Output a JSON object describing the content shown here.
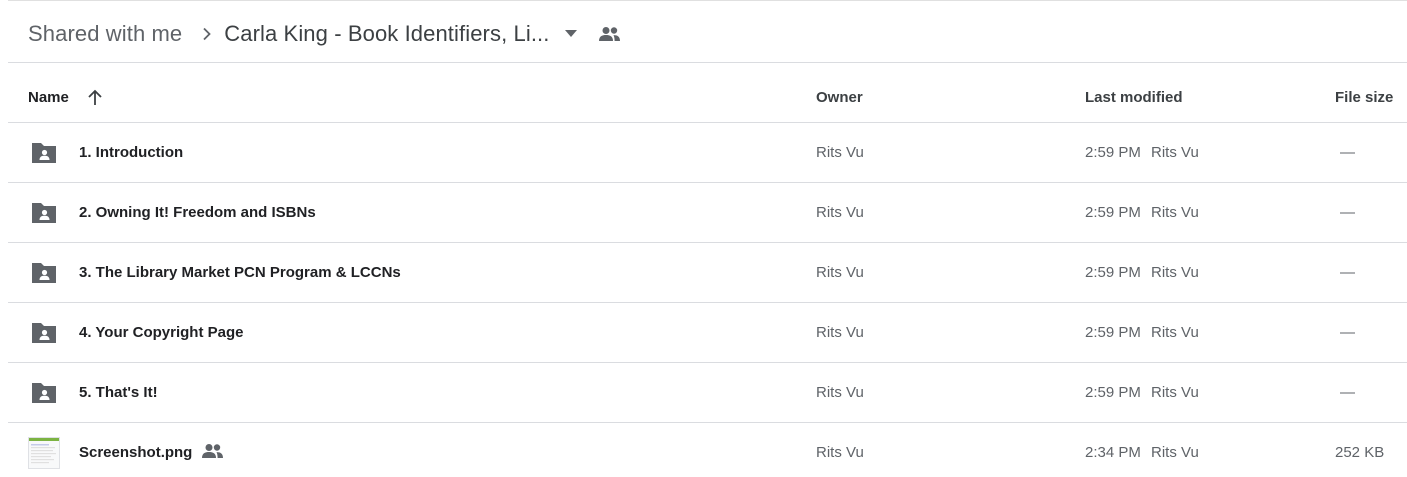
{
  "breadcrumb": {
    "root": "Shared with me",
    "current": "Carla King - Book Identifiers, Li..."
  },
  "columns": {
    "name": "Name",
    "owner": "Owner",
    "last_modified": "Last modified",
    "file_size": "File size"
  },
  "rows": [
    {
      "name": "1. Introduction",
      "type": "shared-folder-icon",
      "owner": "Rits Vu",
      "time": "2:59 PM",
      "modified_by": "Rits Vu",
      "size": "—"
    },
    {
      "name": "2. Owning It! Freedom and ISBNs",
      "type": "shared-folder-icon",
      "owner": "Rits Vu",
      "time": "2:59 PM",
      "modified_by": "Rits Vu",
      "size": "—"
    },
    {
      "name": "3. The Library Market PCN Program & LCCNs",
      "type": "shared-folder-icon",
      "owner": "Rits Vu",
      "time": "2:59 PM",
      "modified_by": "Rits Vu",
      "size": "—"
    },
    {
      "name": "4. Your Copyright Page",
      "type": "shared-folder-icon",
      "owner": "Rits Vu",
      "time": "2:59 PM",
      "modified_by": "Rits Vu",
      "size": "—"
    },
    {
      "name": "5. That's It!",
      "type": "shared-folder-icon",
      "owner": "Rits Vu",
      "time": "2:59 PM",
      "modified_by": "Rits Vu",
      "size": "—"
    },
    {
      "name": "Screenshot.png",
      "type": "image-thumbnail",
      "owner": "Rits Vu",
      "time": "2:34 PM",
      "modified_by": "Rits Vu",
      "size": "252 KB"
    }
  ],
  "colors": {
    "icon_gray": "#5f6368",
    "divider": "#dadce0",
    "text_primary": "#202124"
  }
}
